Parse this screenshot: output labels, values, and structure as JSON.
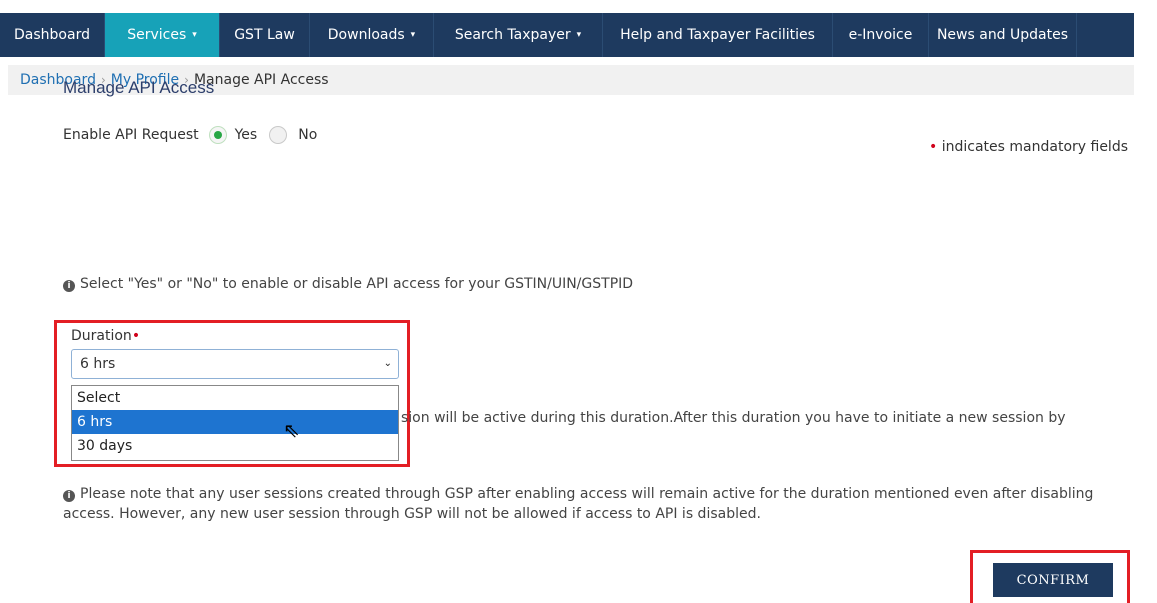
{
  "nav": {
    "items": [
      {
        "label": "Dashboard",
        "caret": false
      },
      {
        "label": "Services",
        "caret": true
      },
      {
        "label": "GST Law",
        "caret": false
      },
      {
        "label": "Downloads",
        "caret": true
      },
      {
        "label": "Search Taxpayer",
        "caret": true
      },
      {
        "label": "Help and Taxpayer Facilities",
        "caret": false
      },
      {
        "label": "e-Invoice",
        "caret": false
      },
      {
        "label": "News and Updates",
        "caret": false
      }
    ],
    "active_label": "Services",
    "caret_glyph": "▾",
    "colors": {
      "bar": "#1e3a5f",
      "active": "#17a2b8"
    }
  },
  "breadcrumb": {
    "items": [
      "Dashboard",
      "My Profile"
    ],
    "separator": "›",
    "current": "Manage API Access"
  },
  "page": {
    "mandatory_star": "•",
    "mandatory_note": "indicates mandatory fields",
    "title": "Manage API Access",
    "enable_label": "Enable API Request",
    "yes_label": "Yes",
    "no_label": "No",
    "selected_option": "Yes",
    "info_icon": "i",
    "info_select": "Select \"Yes\" or \"No\" to enable or disable API access for your GSTIN/UIN/GSTPID",
    "duration_label": "Duration",
    "duration_value": "6 hrs",
    "duration_options": [
      "Select",
      "6 hrs",
      "30 days"
    ],
    "duration_highlighted": "6 hrs",
    "session_text": "sion will be active during this duration.After this duration you have to initiate a new session by",
    "note_line1": "Please note that any user sessions created through GSP after enabling access will remain active for the duration mentioned even after disabling",
    "note_line2": "access. However, any new user session through GSP will not be allowed if access to API is disabled.",
    "confirm_label": "CONFIRM",
    "chevron": "⌄",
    "cursor_glyph": "⇖",
    "highlight_color": "#e31e24"
  }
}
